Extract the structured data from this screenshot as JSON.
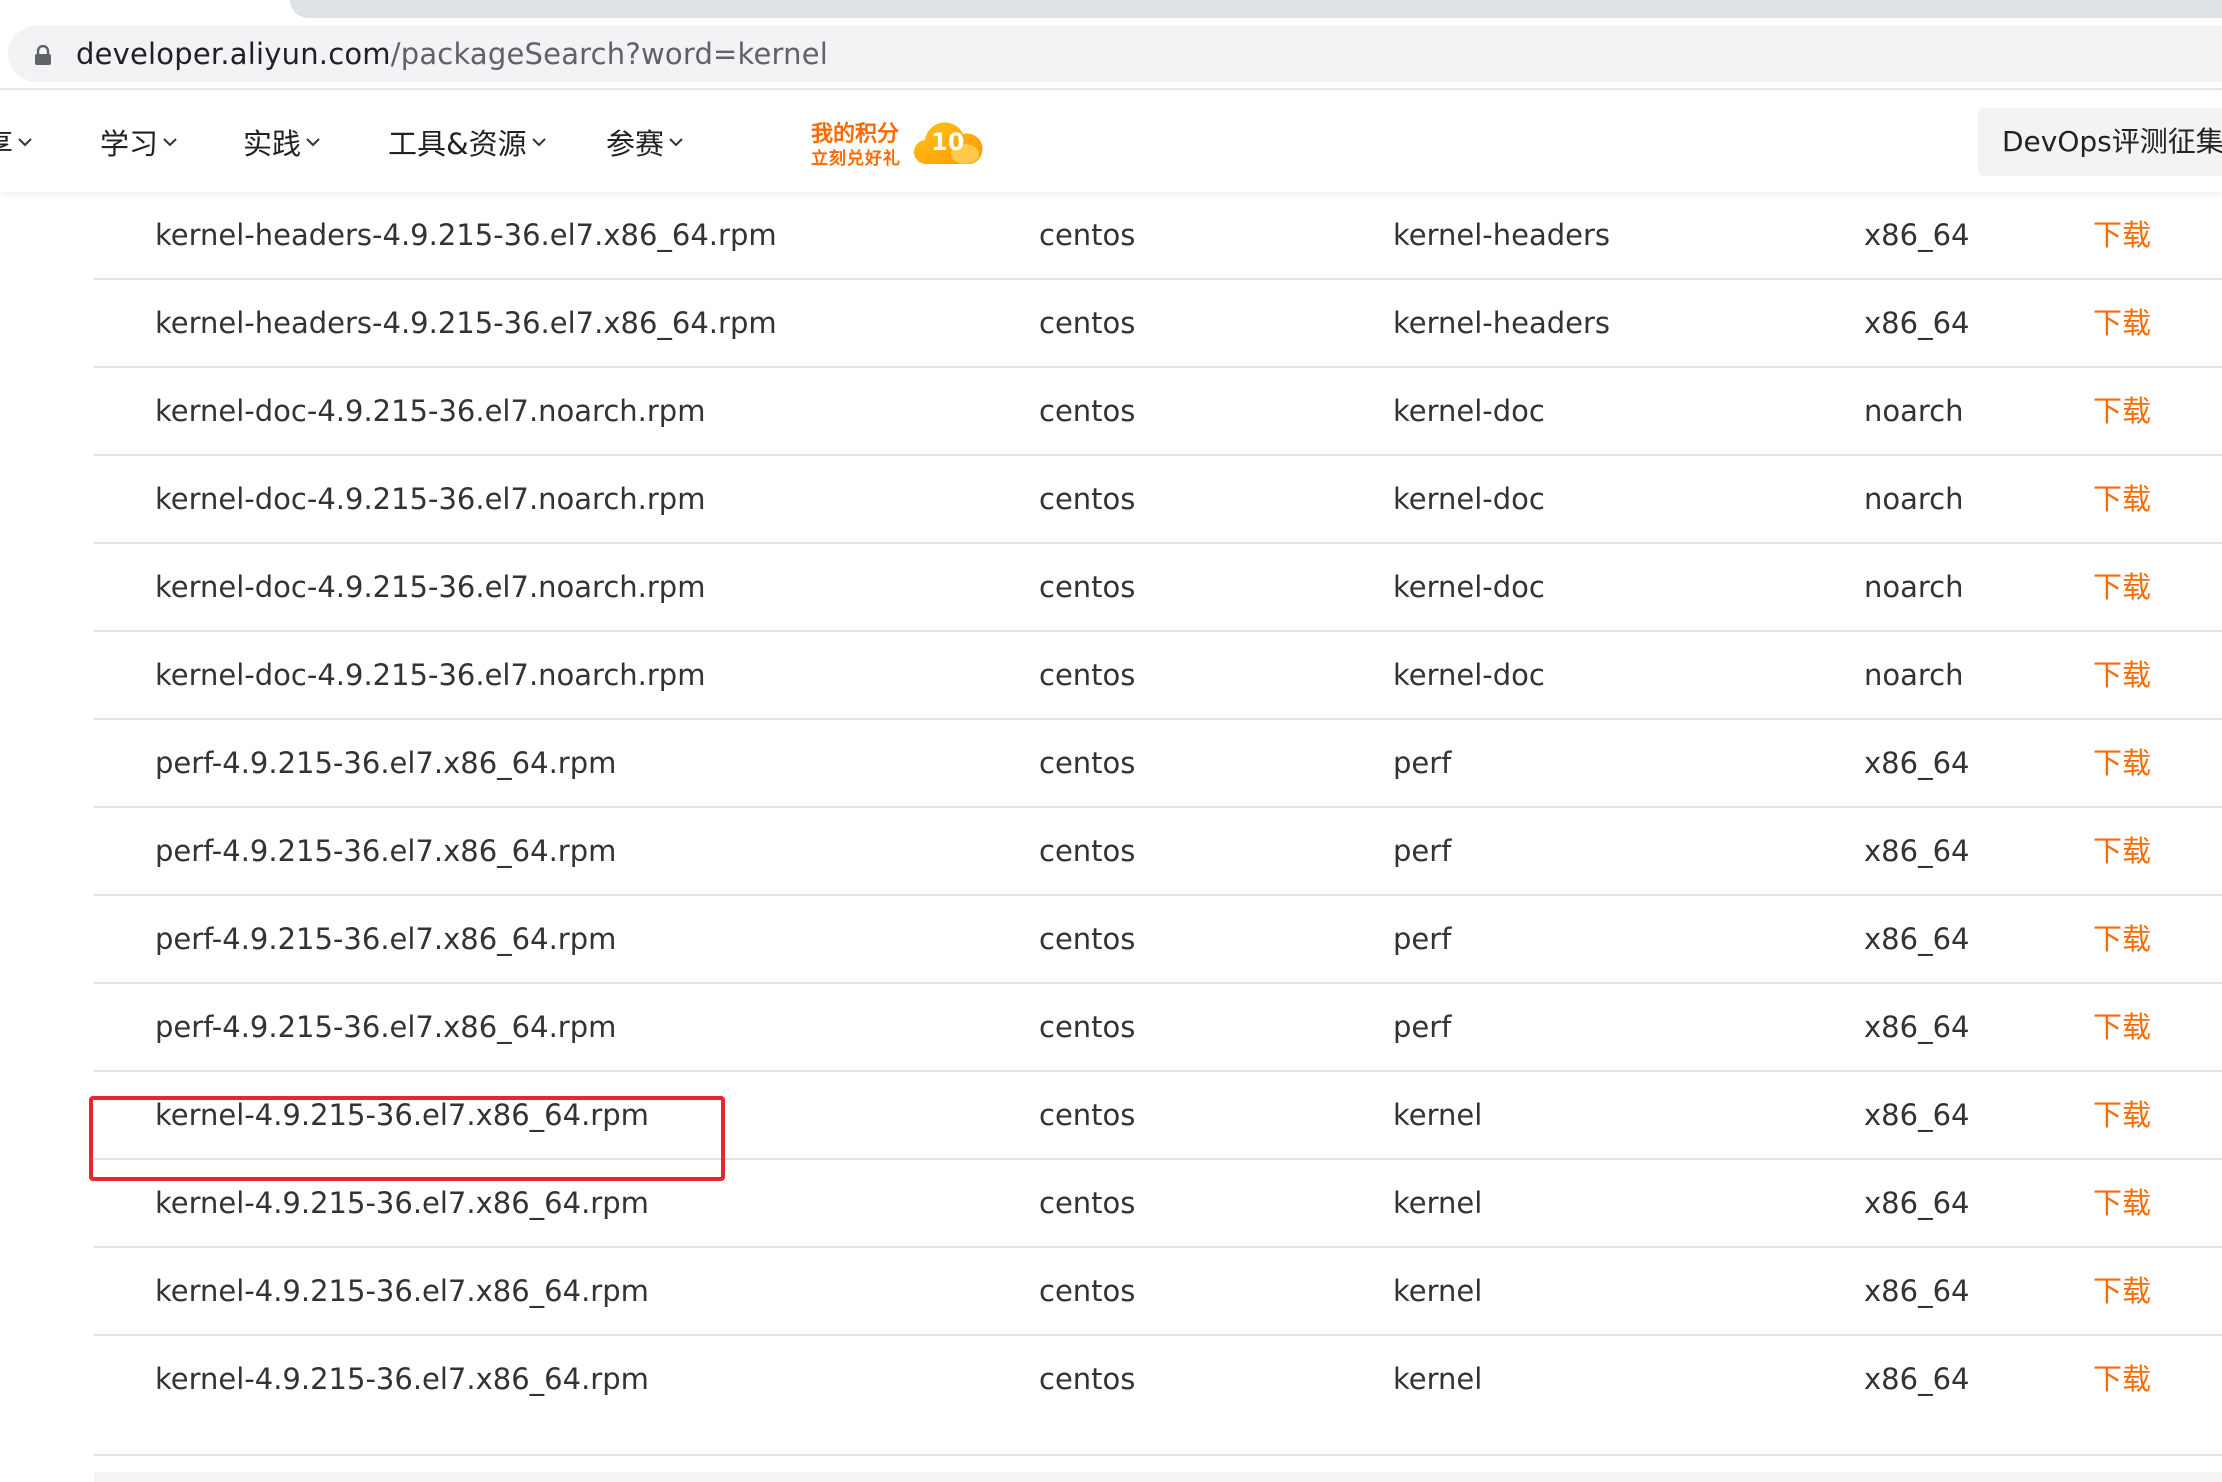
{
  "browser": {
    "url_host": "developer.aliyun.com",
    "url_path": "/packageSearch?word=kernel"
  },
  "nav": {
    "items": [
      {
        "label": "享"
      },
      {
        "label": "学习"
      },
      {
        "label": "实践"
      },
      {
        "label": "工具&资源"
      },
      {
        "label": "参赛"
      }
    ],
    "points_title": "我的积分",
    "points_subtitle": "立刻兑好礼",
    "points_value": "10",
    "promo": "DevOps评测征集令"
  },
  "table": {
    "download_label": "下载",
    "rows": [
      {
        "name": "kernel-headers-4.9.215-36.el7.x86_64.rpm",
        "os": "centos",
        "package": "kernel-headers",
        "arch": "x86_64"
      },
      {
        "name": "kernel-headers-4.9.215-36.el7.x86_64.rpm",
        "os": "centos",
        "package": "kernel-headers",
        "arch": "x86_64"
      },
      {
        "name": "kernel-doc-4.9.215-36.el7.noarch.rpm",
        "os": "centos",
        "package": "kernel-doc",
        "arch": "noarch"
      },
      {
        "name": "kernel-doc-4.9.215-36.el7.noarch.rpm",
        "os": "centos",
        "package": "kernel-doc",
        "arch": "noarch"
      },
      {
        "name": "kernel-doc-4.9.215-36.el7.noarch.rpm",
        "os": "centos",
        "package": "kernel-doc",
        "arch": "noarch"
      },
      {
        "name": "kernel-doc-4.9.215-36.el7.noarch.rpm",
        "os": "centos",
        "package": "kernel-doc",
        "arch": "noarch"
      },
      {
        "name": "perf-4.9.215-36.el7.x86_64.rpm",
        "os": "centos",
        "package": "perf",
        "arch": "x86_64"
      },
      {
        "name": "perf-4.9.215-36.el7.x86_64.rpm",
        "os": "centos",
        "package": "perf",
        "arch": "x86_64"
      },
      {
        "name": "perf-4.9.215-36.el7.x86_64.rpm",
        "os": "centos",
        "package": "perf",
        "arch": "x86_64"
      },
      {
        "name": "perf-4.9.215-36.el7.x86_64.rpm",
        "os": "centos",
        "package": "perf",
        "arch": "x86_64"
      },
      {
        "name": "kernel-4.9.215-36.el7.x86_64.rpm",
        "os": "centos",
        "package": "kernel",
        "arch": "x86_64",
        "highlighted": true
      },
      {
        "name": "kernel-4.9.215-36.el7.x86_64.rpm",
        "os": "centos",
        "package": "kernel",
        "arch": "x86_64"
      },
      {
        "name": "kernel-4.9.215-36.el7.x86_64.rpm",
        "os": "centos",
        "package": "kernel",
        "arch": "x86_64"
      },
      {
        "name": "kernel-4.9.215-36.el7.x86_64.rpm",
        "os": "centos",
        "package": "kernel",
        "arch": "x86_64"
      }
    ]
  },
  "colors": {
    "accent": "#ff6a00",
    "highlight_border": "#e8262b"
  }
}
